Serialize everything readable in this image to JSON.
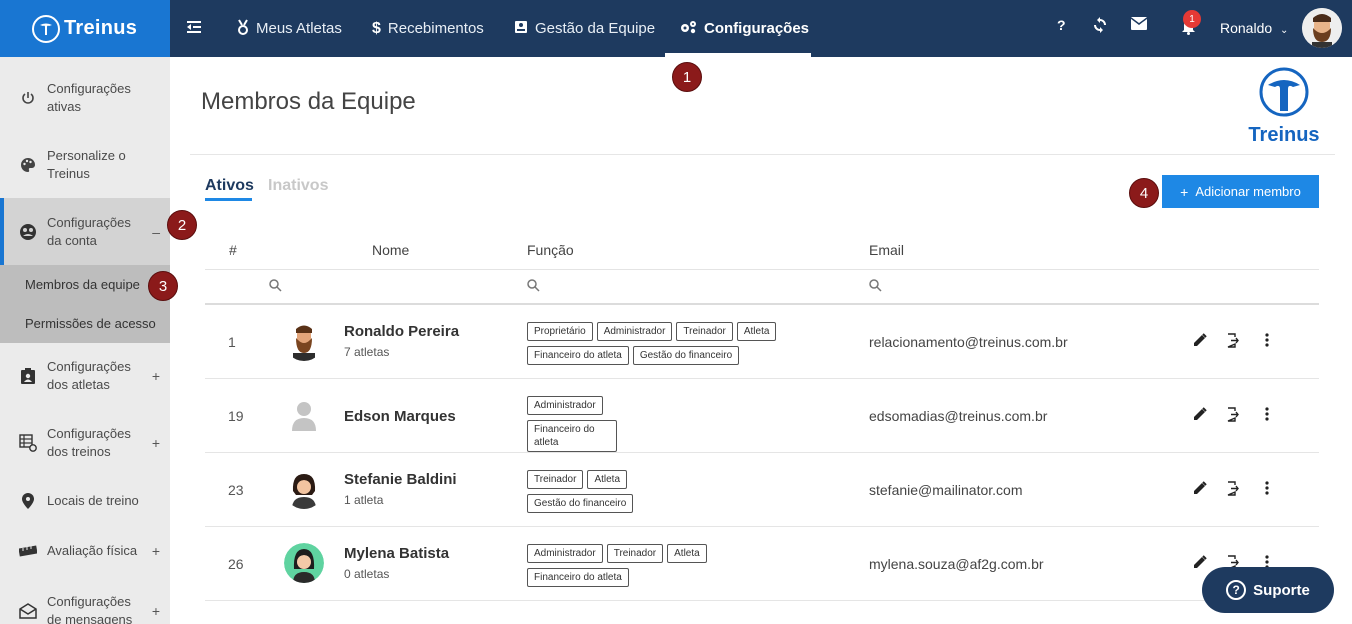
{
  "topbar": {
    "logo_text": "Treinus",
    "nav": [
      {
        "label": "Meus Atletas",
        "icon": "medal-icon"
      },
      {
        "label": "Recebimentos",
        "icon": "dollar-icon"
      },
      {
        "label": "Gestão da Equipe",
        "icon": "id-card-icon"
      },
      {
        "label": "Configurações",
        "icon": "gears-icon",
        "active": true
      }
    ],
    "help": "?",
    "notification_count": "1",
    "user_name": "Ronaldo",
    "accent": "#1976d2",
    "bar_color": "#1e3a5f"
  },
  "sidebar": {
    "items": [
      {
        "label_1": "Configurações",
        "label_2": "ativas",
        "icon": "power-icon"
      },
      {
        "label_1": "Personalize o",
        "label_2": "Treinus",
        "icon": "palette-icon"
      },
      {
        "label_1": "Configurações",
        "label_2": "da conta",
        "icon": "account-circle-icon",
        "toggle": "–"
      },
      {
        "label_1": "Configurações",
        "label_2": "dos atletas",
        "icon": "badge-icon",
        "toggle": "+"
      },
      {
        "label_1": "Configurações",
        "label_2": "dos treinos",
        "icon": "training-grid-icon",
        "toggle": "+"
      },
      {
        "label_1": "Locais de treino",
        "icon": "location-pin-icon"
      },
      {
        "label_1": "Avaliação física",
        "icon": "ruler-icon",
        "toggle": "+"
      },
      {
        "label_1": "Configurações",
        "label_2": "de mensagens",
        "icon": "envelope-icon",
        "toggle": "+"
      }
    ],
    "sub_items": [
      "Membros da equipe",
      "Permissões de acesso"
    ]
  },
  "main": {
    "title": "Membros da Equipe",
    "brand_text": "Treinus",
    "tabs": [
      "Ativos",
      "Inativos"
    ],
    "add_button": "Adicionar membro",
    "columns": [
      "#",
      "Nome",
      "Função",
      "Email"
    ],
    "rows": [
      {
        "id": "1",
        "name": "Ronaldo Pereira",
        "sub": "7 atletas",
        "tags": [
          "Proprietário",
          "Administrador",
          "Treinador",
          "Atleta",
          "Financeiro do atleta",
          "Gestão do financeiro"
        ],
        "email": "relacionamento@treinus.com.br",
        "avatar": "bearded-man-avatar"
      },
      {
        "id": "19",
        "name": "Edson Marques",
        "sub": "",
        "tags": [
          "Administrador",
          "Financeiro do atleta"
        ],
        "email": "edsomadias@treinus.com.br",
        "avatar": "default-user-avatar"
      },
      {
        "id": "23",
        "name": "Stefanie Baldini",
        "sub": "1 atleta",
        "tags": [
          "Treinador",
          "Atleta",
          "Gestão do financeiro"
        ],
        "email": "stefanie@mailinator.com",
        "avatar": "woman-avatar"
      },
      {
        "id": "26",
        "name": "Mylena Batista",
        "sub": "0 atletas",
        "tags": [
          "Administrador",
          "Treinador",
          "Atleta",
          "Financeiro do atleta"
        ],
        "email": "mylena.souza@af2g.com.br",
        "avatar": "woman-green-avatar"
      }
    ]
  },
  "callouts": [
    "1",
    "2",
    "3",
    "4"
  ],
  "support_label": "Suporte"
}
